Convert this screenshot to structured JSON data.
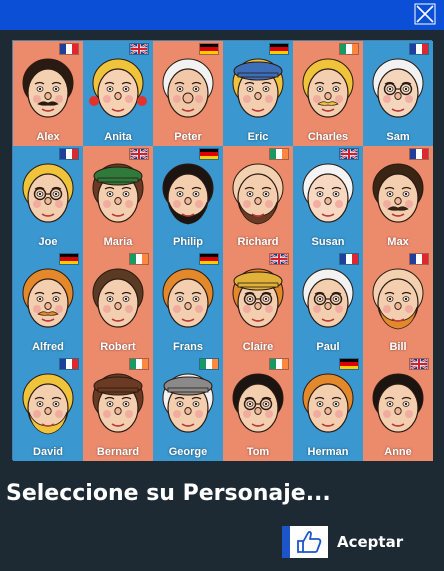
{
  "window": {
    "close_icon": "close-icon"
  },
  "board": {
    "characters": [
      {
        "name": "Alex",
        "flag": "fr",
        "card": "salmon",
        "hair": "#2a1a12",
        "skin": "#f3d0b0",
        "mustache": true
      },
      {
        "name": "Anita",
        "flag": "uk",
        "card": "blue",
        "hair": "#f0c43a",
        "skin": "#f6d2b3",
        "bows": true
      },
      {
        "name": "Peter",
        "flag": "de",
        "card": "salmon",
        "hair": "#f2f2f2",
        "skin": "#f1c9a8",
        "nose": true
      },
      {
        "name": "Eric",
        "flag": "de",
        "card": "blue",
        "hair": "#f0c43a",
        "skin": "#f3cfb0",
        "hat": "#3d6fb8"
      },
      {
        "name": "Charles",
        "flag": "ie",
        "card": "salmon",
        "hair": "#f0c43a",
        "skin": "#f3cfb0",
        "mustache": true
      },
      {
        "name": "Sam",
        "flag": "fr",
        "card": "blue",
        "hair": "#f2f2f2",
        "skin": "#f4d6bd",
        "glasses": true
      },
      {
        "name": "Joe",
        "flag": "fr",
        "card": "blue",
        "hair": "#f0c43a",
        "skin": "#f3cfb0",
        "glasses": true
      },
      {
        "name": "Maria",
        "flag": "uk",
        "card": "salmon",
        "hair": "#6a3b22",
        "skin": "#f3cfb0",
        "hat": "#2f7a3a"
      },
      {
        "name": "Philip",
        "flag": "de",
        "card": "blue",
        "hair": "#1c1410",
        "skin": "#f3cfb0",
        "beard": "#1c1410"
      },
      {
        "name": "Richard",
        "flag": "ie",
        "card": "salmon",
        "hair": "#f3d0b0",
        "skin": "#f3cfb0",
        "beard": "#6a3b22"
      },
      {
        "name": "Susan",
        "flag": "uk",
        "card": "blue",
        "hair": "#f4f4f4",
        "skin": "#f7d8c2"
      },
      {
        "name": "Max",
        "flag": "fr",
        "card": "salmon",
        "hair": "#3a2414",
        "skin": "#f3cfb0",
        "mustache": true
      },
      {
        "name": "Alfred",
        "flag": "de",
        "card": "blue",
        "hair": "#e3892b",
        "skin": "#f3cfb0",
        "mustache": true
      },
      {
        "name": "Robert",
        "flag": "ie",
        "card": "salmon",
        "hair": "#5a3a22",
        "skin": "#f3cfb0"
      },
      {
        "name": "Frans",
        "flag": "de",
        "card": "blue",
        "hair": "#e3892b",
        "skin": "#f3cfb0"
      },
      {
        "name": "Claire",
        "flag": "uk",
        "card": "salmon",
        "hair": "#e3892b",
        "skin": "#f3cfb0",
        "hat": "#e0b23a",
        "glasses": true
      },
      {
        "name": "Paul",
        "flag": "fr",
        "card": "blue",
        "hair": "#f2f2f2",
        "skin": "#f3cfb0",
        "glasses": true
      },
      {
        "name": "Bill",
        "flag": "fr",
        "card": "salmon",
        "hair": "#f3d0b0",
        "skin": "#f3cfb0",
        "beard": "#e3892b"
      },
      {
        "name": "David",
        "flag": "fr",
        "card": "blue",
        "hair": "#f0c43a",
        "skin": "#f3cfb0",
        "beard": "#f0c43a"
      },
      {
        "name": "Bernard",
        "flag": "ie",
        "card": "salmon",
        "hair": "#6a3b22",
        "skin": "#f3cfb0",
        "hat": "#6a3b22"
      },
      {
        "name": "George",
        "flag": "ie",
        "card": "blue",
        "hair": "#f2f2f2",
        "skin": "#f3cfb0",
        "hat": "#8a8a8a"
      },
      {
        "name": "Tom",
        "flag": "ie",
        "card": "salmon",
        "hair": "#1c1410",
        "skin": "#f3cfb0",
        "glasses": true
      },
      {
        "name": "Herman",
        "flag": "de",
        "card": "blue",
        "hair": "#e3892b",
        "skin": "#f3cfb0"
      },
      {
        "name": "Anne",
        "flag": "uk",
        "card": "salmon",
        "hair": "#1c1410",
        "skin": "#f3cfb0"
      }
    ]
  },
  "footer": {
    "prompt": "Seleccione su Personaje...",
    "accept_label": "Aceptar",
    "accept_icon": "thumbs-up-icon"
  },
  "colors": {
    "titlebar": "#0a4fd6",
    "background": "#1e2a33",
    "card_salmon": "#ec8a6c",
    "card_blue": "#3a97d0"
  }
}
